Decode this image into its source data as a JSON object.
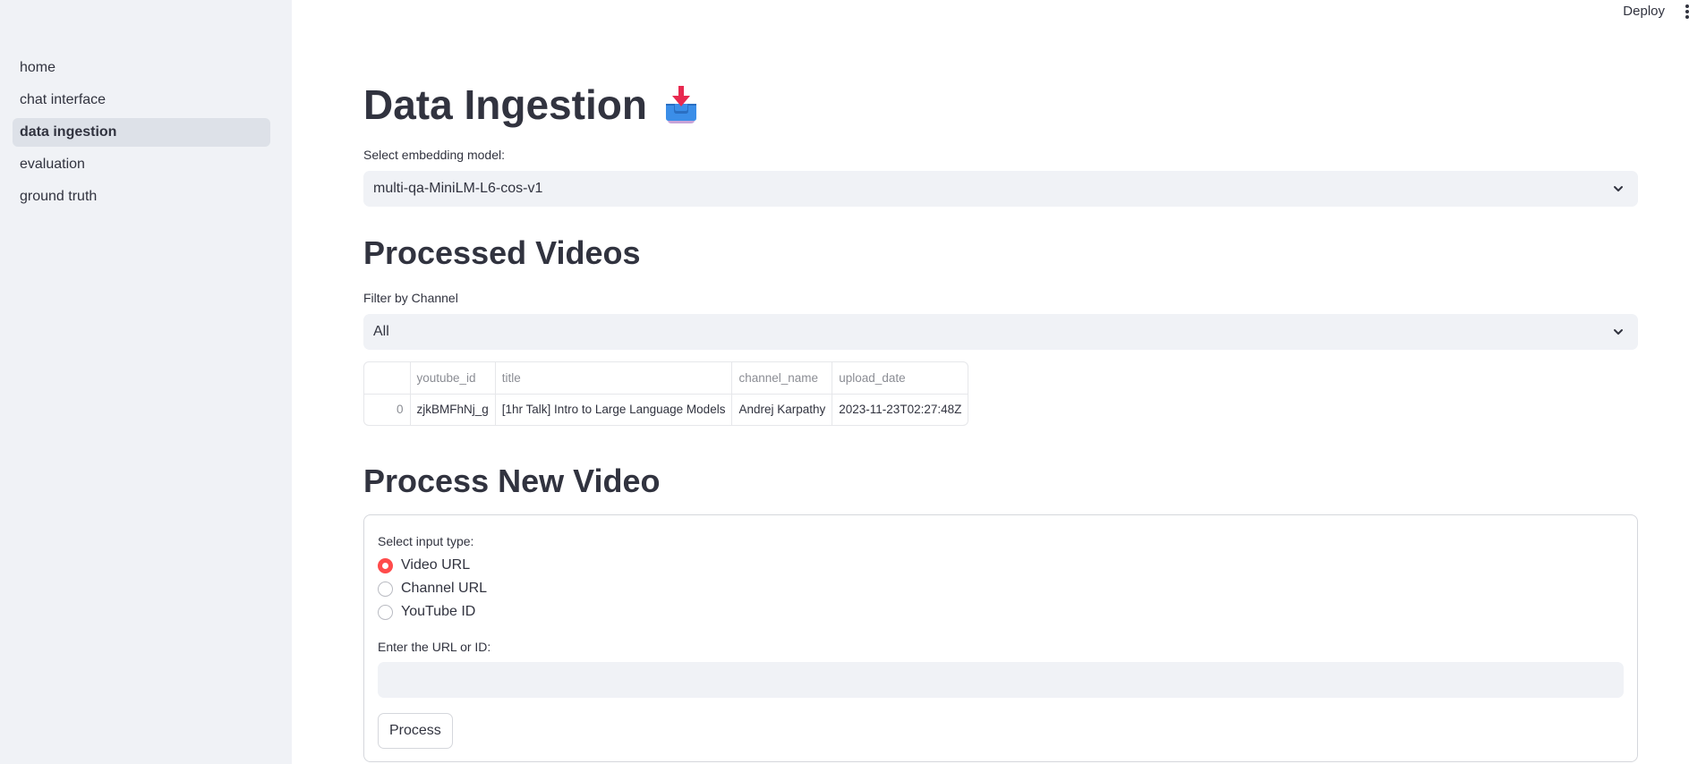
{
  "sidebar": {
    "items": [
      {
        "label": "home",
        "active": false
      },
      {
        "label": "chat interface",
        "active": false
      },
      {
        "label": "data ingestion",
        "active": true
      },
      {
        "label": "evaluation",
        "active": false
      },
      {
        "label": "ground truth",
        "active": false
      }
    ]
  },
  "header": {
    "deploy_label": "Deploy",
    "menu_icon": "kebab-menu-icon"
  },
  "main": {
    "title": "Data Ingestion",
    "title_icon": "inbox-tray-icon",
    "embedding": {
      "label": "Select embedding model:",
      "value": "multi-qa-MiniLM-L6-cos-v1"
    },
    "processed": {
      "heading": "Processed Videos",
      "filter_label": "Filter by Channel",
      "filter_value": "All",
      "table": {
        "columns": [
          "",
          "youtube_id",
          "title",
          "channel_name",
          "upload_date"
        ],
        "rows": [
          [
            "0",
            "zjkBMFhNj_g",
            "[1hr Talk] Intro to Large Language Models",
            "Andrej Karpathy",
            "2023-11-23T02:27:48Z"
          ]
        ]
      }
    },
    "process_new": {
      "heading": "Process New Video",
      "input_type_label": "Select input type:",
      "options": [
        "Video URL",
        "Channel URL",
        "YouTube ID"
      ],
      "selected": "Video URL",
      "url_label": "Enter the URL or ID:",
      "url_value": "",
      "url_placeholder": "",
      "button_label": "Process"
    }
  },
  "colors": {
    "accent": "#ff4b4b",
    "sidebar_bg": "#f0f2f6",
    "active_item_bg": "#dde1e8",
    "text": "#31333f"
  }
}
